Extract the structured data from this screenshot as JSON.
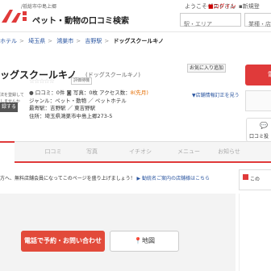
{
  "header": {
    "area_label": "/祇総市中島上郷",
    "site_title": "ペット・動物の口コミ検索",
    "welcome": "ようこそゲストさん",
    "login": "ログイン",
    "register": "新規登",
    "search_station_placeholder": "駅・エリア",
    "search_keyword_placeholder": "業種・店名・"
  },
  "breadcrumb": [
    "ホテル",
    "埼玉県",
    "鴻巣市",
    "吉野駅",
    "ドッグスクールキノ"
  ],
  "shop": {
    "name": "ッグスクールキノ",
    "kana": "(ドッグスクールキノ)",
    "fav_label": "お気に入り追加",
    "cta_label": "電",
    "report_label": "▼店舗情報訂正を見う",
    "no_rating": "評価待機",
    "reviews": "口コミ：0件",
    "photos": "写真：0枚",
    "access_count_label": "アクセス数：",
    "access_count": "8(先月)",
    "genre": "ジャンル：ペット・動物 ／ ペットホテル",
    "nearest_station": "最寄駅：吉野駅 ／ 東吉野駅",
    "address": "住所：埼玉県鴻巣市中島上郷273-5",
    "profile_text_1": "法を登録して",
    "profile_text_2": "しませんか",
    "profile_button": "録する",
    "kuchikomi_label": "口コミ投"
  },
  "tabs": [
    "口コミ",
    "写真",
    "イチオシ",
    "メニュー",
    "お知らせ"
  ],
  "notice": {
    "text": "方へ、無料店舗会員になってこのページを盛り上げましょう！",
    "link": "▶ 勧統名ご案内の店舗様はこちら"
  },
  "side": {
    "title": "この"
  },
  "actions": {
    "call_label": "電話で予約・お問い合わせ",
    "map_label": "地図"
  }
}
